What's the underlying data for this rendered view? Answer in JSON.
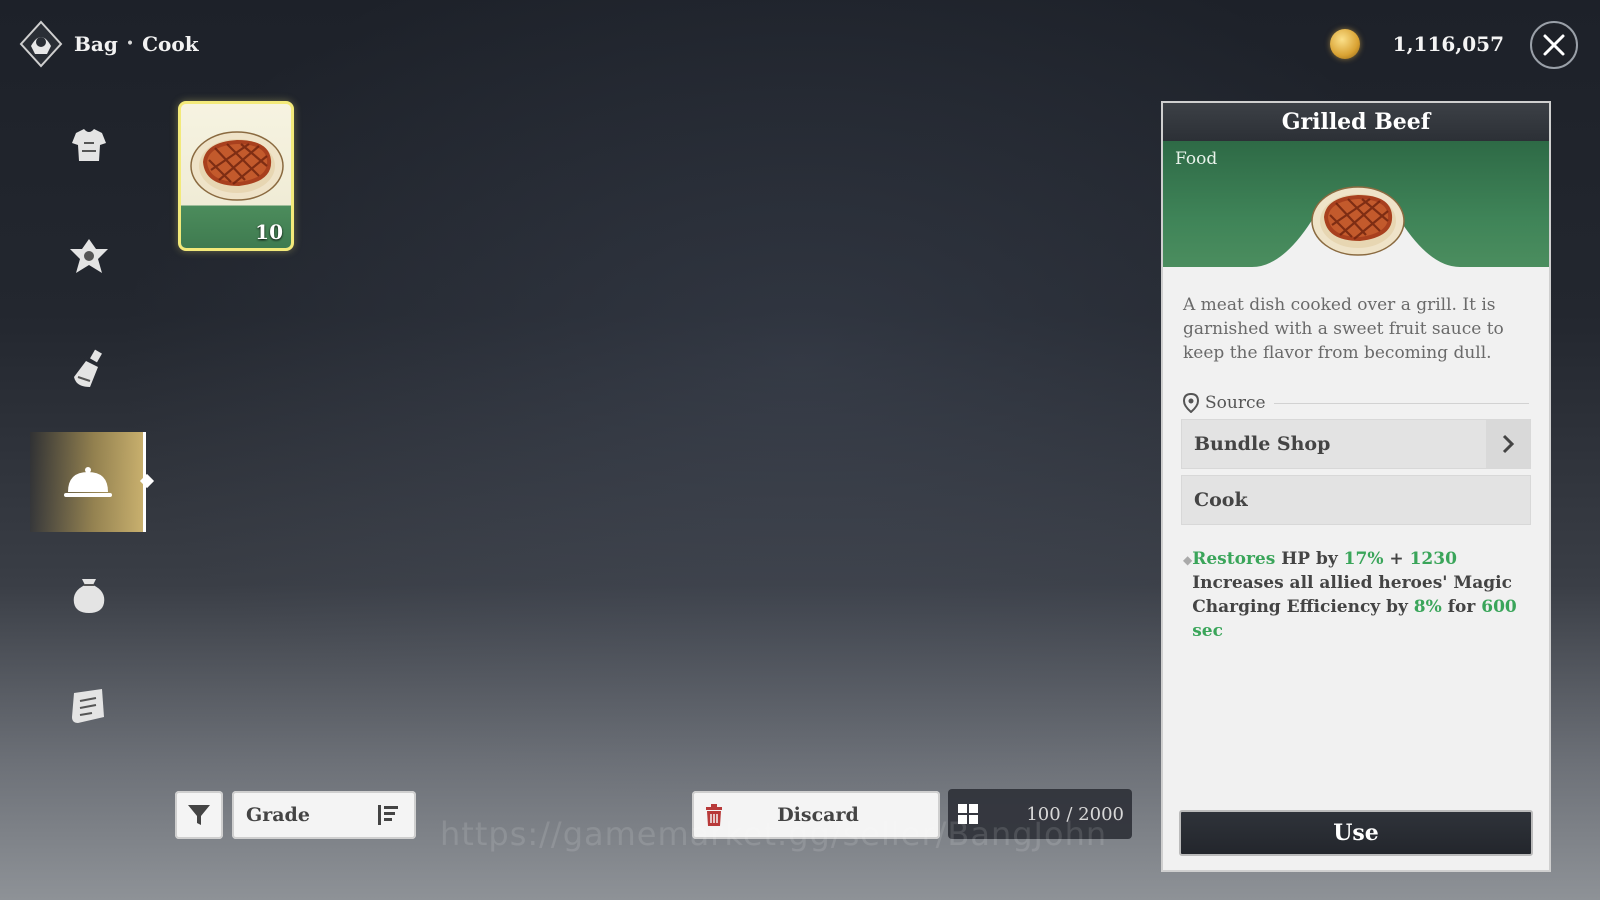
{
  "header": {
    "breadcrumb_main": "Bag",
    "breadcrumb_separator": "•",
    "breadcrumb_current": "Cook",
    "currency_value": "1,116,057"
  },
  "sidebar": {
    "items": [
      {
        "icon": "armor-icon",
        "active": false
      },
      {
        "icon": "gem-icon",
        "active": false
      },
      {
        "icon": "potion-icon",
        "active": false
      },
      {
        "icon": "cloche-icon",
        "active": true
      },
      {
        "icon": "pouch-icon",
        "active": false
      },
      {
        "icon": "scroll-icon",
        "active": false
      }
    ]
  },
  "inventory": {
    "items": [
      {
        "name": "Grilled Beef",
        "quantity": "10",
        "selected": true
      }
    ]
  },
  "toolbar": {
    "sort_label": "Grade",
    "discard_label": "Discard",
    "capacity": "100 / 2000"
  },
  "watermark": "https://gamemarket.gg/seller/BangJohn",
  "detail": {
    "title": "Grilled Beef",
    "category": "Food",
    "description": "A meat dish cooked over a grill. It is garnished with a sweet fruit sauce to keep the flavor from becoming dull.",
    "source_label": "Source",
    "sources": [
      "Bundle Shop",
      "Cook"
    ],
    "effect": {
      "restores": "Restores",
      "hp_by": "HP by",
      "percent": "17%",
      "plus": "+",
      "flat": "1230",
      "line2": "Increases all allied heroes' Magic Charging Efficiency by",
      "buff_percent": "8%",
      "for": "for",
      "duration": "600 sec"
    },
    "use_label": "Use"
  },
  "colors": {
    "accent_green": "#3aa55a",
    "card_border": "#f3ea7a",
    "panel_green": "#3f8458"
  }
}
